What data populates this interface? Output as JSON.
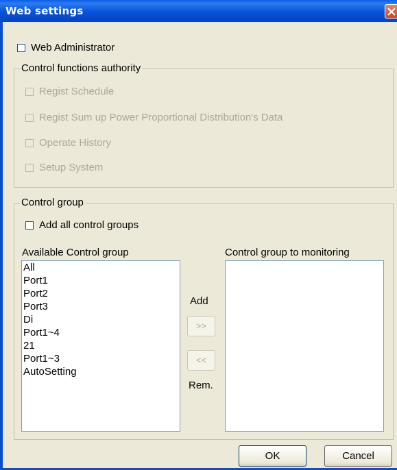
{
  "window": {
    "title": "Web settings"
  },
  "web_admin": {
    "label": "Web Administrator",
    "checked": false
  },
  "control_functions": {
    "legend": "Control functions authority",
    "items": [
      {
        "label": "Regist Schedule"
      },
      {
        "label": "Regist Sum up Power Proportional Distribution's Data"
      },
      {
        "label": "Operate History"
      },
      {
        "label": "Setup System"
      }
    ]
  },
  "control_group": {
    "legend": "Control group",
    "add_all_label": "Add all control groups",
    "available_label": "Available Control group",
    "monitoring_label": "Control group to monitoring",
    "available_items": [
      "All",
      "Port1",
      "Port2",
      "Port3",
      "Di",
      "Port1~4",
      "21",
      "Port1~3",
      "AutoSetting"
    ],
    "monitoring_items": [],
    "add_label": "Add",
    "add_button": ">>",
    "remove_button": "<<",
    "remove_label": "Rem."
  },
  "footer": {
    "ok": "OK",
    "cancel": "Cancel"
  }
}
